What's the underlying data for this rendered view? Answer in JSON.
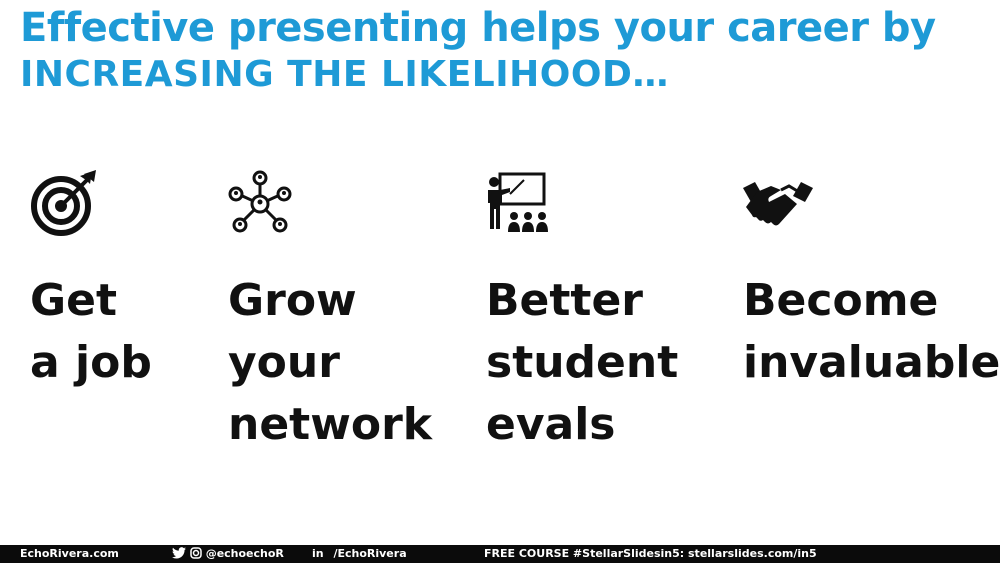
{
  "title": {
    "line1": "Effective presenting helps your career by",
    "line2": "INCREASING THE LIKELIHOOD…"
  },
  "columns": [
    {
      "icon": "target-icon",
      "lines": [
        "Get",
        "a job"
      ]
    },
    {
      "icon": "network-icon",
      "lines": [
        "Grow",
        "your",
        "network"
      ]
    },
    {
      "icon": "presenter-icon",
      "lines": [
        "Better",
        "student",
        "evals"
      ]
    },
    {
      "icon": "handshake-icon",
      "lines": [
        "Become",
        "invaluable"
      ]
    }
  ],
  "footer": {
    "website": "EchoRivera.com",
    "social_handle": "@echoechoR",
    "linkedin": "/EchoRivera",
    "course": "FREE COURSE #StellarSlidesin5: stellarslides.com/in5"
  },
  "colors": {
    "accent": "#1e9ad6",
    "text": "#111111",
    "footer_bg": "#0b0b0b"
  }
}
